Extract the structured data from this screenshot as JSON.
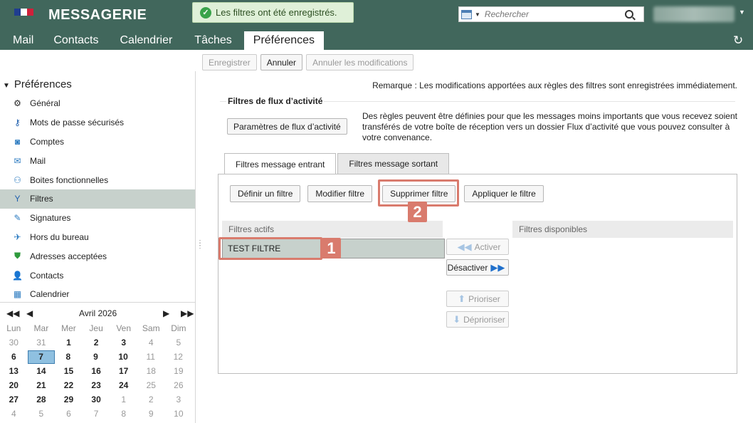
{
  "header": {
    "app_title": "MESSAGERIE",
    "toast": "Les filtres ont été enregistrés.",
    "search_placeholder": "Rechercher",
    "colors": {
      "bar": "#41675c",
      "accent": "#d97b6d"
    }
  },
  "nav_tabs": [
    "Mail",
    "Contacts",
    "Calendrier",
    "Tâches",
    "Préférences"
  ],
  "toolbar": {
    "save": "Enregistrer",
    "cancel": "Annuler",
    "cancel_changes": "Annuler les modifications"
  },
  "sidebar": {
    "title": "Préférences",
    "items": [
      {
        "label": "Général",
        "icon": "gear-icon"
      },
      {
        "label": "Mots de passe sécurisés",
        "icon": "key-icon"
      },
      {
        "label": "Comptes",
        "icon": "account-icon"
      },
      {
        "label": "Mail",
        "icon": "envelope-icon"
      },
      {
        "label": "Boites fonctionnelles",
        "icon": "shared-mailbox-icon"
      },
      {
        "label": "Filtres",
        "icon": "filter-icon"
      },
      {
        "label": "Signatures",
        "icon": "signature-icon"
      },
      {
        "label": "Hors du bureau",
        "icon": "out-of-office-icon"
      },
      {
        "label": "Adresses acceptées",
        "icon": "shield-icon"
      },
      {
        "label": "Contacts",
        "icon": "contact-icon"
      },
      {
        "label": "Calendrier",
        "icon": "calendar-icon"
      }
    ],
    "selected": "Filtres"
  },
  "minical": {
    "month": "Avril 2026",
    "days": [
      "Lun",
      "Mar",
      "Mer",
      "Jeu",
      "Ven",
      "Sam",
      "Dim"
    ],
    "weeks": [
      [
        "30",
        "31",
        "1",
        "2",
        "3",
        "4",
        "5"
      ],
      [
        "6",
        "7",
        "8",
        "9",
        "10",
        "11",
        "12"
      ],
      [
        "13",
        "14",
        "15",
        "16",
        "17",
        "18",
        "19"
      ],
      [
        "20",
        "21",
        "22",
        "23",
        "24",
        "25",
        "26"
      ],
      [
        "27",
        "28",
        "29",
        "30",
        "1",
        "2",
        "3"
      ],
      [
        "4",
        "5",
        "6",
        "7",
        "8",
        "9",
        "10"
      ]
    ],
    "today": "7"
  },
  "main": {
    "note": "Remarque : Les modifications apportées aux règles des filtres sont enregistrées immédiatement.",
    "activity": {
      "legend": "Filtres de flux d’activité",
      "button": "Paramètres de flux d’activité",
      "description": "Des règles peuvent être définies pour que les messages moins importants que vous recevez soient transférés de votre boîte de réception vers un dossier Flux d’activité que vous pouvez consulter à votre convenance."
    },
    "filter_tabs": [
      "Filtres message entrant",
      "Filtres message sortant"
    ],
    "buttons": [
      "Définir un filtre",
      "Modifier filtre",
      "Supprimer filtre",
      "Appliquer le filtre"
    ],
    "active_header": "Filtres actifs",
    "active_filters": [
      "TEST FILTRE"
    ],
    "available_header": "Filtres disponibles",
    "move": {
      "activate": "Activer",
      "deactivate": "Désactiver",
      "prioritize": "Prioriser",
      "deprioritize": "Déprioriser"
    },
    "callouts": [
      "1",
      "2"
    ]
  }
}
